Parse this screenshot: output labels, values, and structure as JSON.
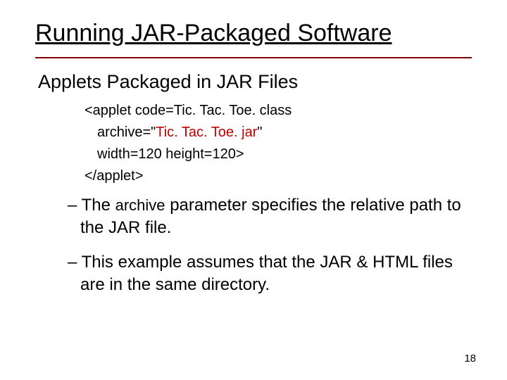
{
  "title": "Running JAR-Packaged Software",
  "subtitle": "Applets Packaged in JAR Files",
  "code": {
    "line1": "<applet code=Tic. Tac. Toe. class",
    "line2_prefix": "archive=\"",
    "line2_highlight": "Tic. Tac. Toe. jar",
    "line2_suffix": "\"",
    "line3": "width=120 height=120>",
    "line4": "</applet>"
  },
  "bullets": {
    "b1_prefix": "– The ",
    "b1_mono": "archive",
    "b1_suffix": " parameter specifies the relative path to the JAR file.",
    "b2": "– This example assumes that the JAR & HTML files are in the same directory."
  },
  "pagenum": "18"
}
